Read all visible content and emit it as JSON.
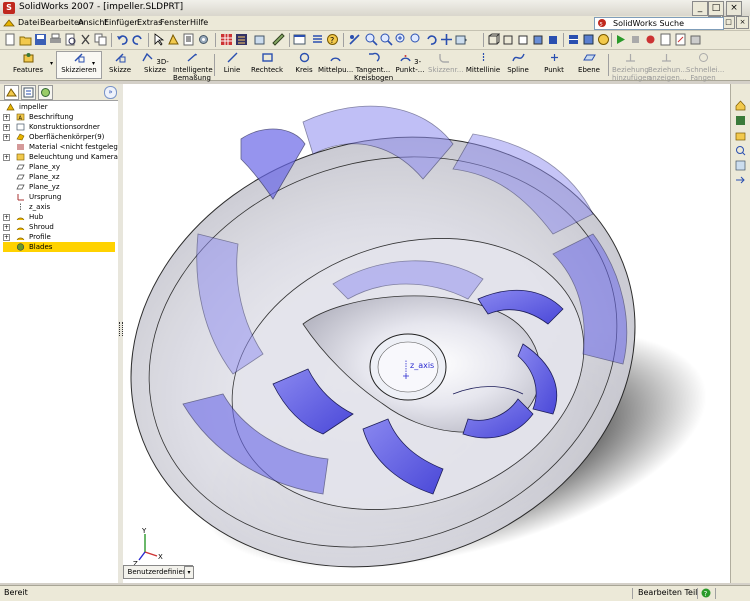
{
  "window": {
    "title": "SolidWorks 2007 - [impeller.SLDPRT]",
    "app_icon": "solidworks-logo",
    "controls": [
      "minimize",
      "restore",
      "close"
    ],
    "doc_controls": [
      "minimize",
      "restore",
      "close"
    ]
  },
  "menu": {
    "items": [
      "Datei",
      "Bearbeiten",
      "Ansicht",
      "Einfügen",
      "Extras",
      "Fenster",
      "Hilfe"
    ],
    "search_placeholder": "SolidWorks Suche"
  },
  "command_manager": {
    "groups": [
      {
        "label": "Features",
        "icon": "features-icon"
      },
      {
        "label": "Skizzieren",
        "icon": "sketch-tab-icon"
      }
    ],
    "tools": [
      {
        "label": "Skizze",
        "icon": "sketch-icon",
        "enabled": true
      },
      {
        "label": "3D-Skizze",
        "icon": "3d-sketch-icon",
        "enabled": true
      },
      {
        "label": "Intelligente Bemaßung",
        "icon": "smart-dimension-icon",
        "enabled": true
      },
      {
        "label": "Linie",
        "icon": "line-icon",
        "enabled": true
      },
      {
        "label": "Rechteck",
        "icon": "rectangle-icon",
        "enabled": true
      },
      {
        "label": "Kreis",
        "icon": "circle-icon",
        "enabled": true
      },
      {
        "label": "Mittelpu...",
        "icon": "centerpoint-arc-icon",
        "enabled": true
      },
      {
        "label": "Tangent... Kreisbogen",
        "icon": "tangent-arc-icon",
        "enabled": true
      },
      {
        "label": "3-Punkt-...",
        "icon": "3-point-arc-icon",
        "enabled": true
      },
      {
        "label": "Skizzenr...",
        "icon": "sketch-fillet-icon",
        "enabled": false
      },
      {
        "label": "Mittellinie",
        "icon": "centerline-icon",
        "enabled": true
      },
      {
        "label": "Spline",
        "icon": "spline-icon",
        "enabled": true
      },
      {
        "label": "Punkt",
        "icon": "point-icon",
        "enabled": true
      },
      {
        "label": "Ebene",
        "icon": "plane-icon",
        "enabled": true
      },
      {
        "label": "Beziehung hinzufügen",
        "icon": "add-relation-icon",
        "enabled": false
      },
      {
        "label": "Beziehun... anzeigen...",
        "icon": "display-relations-icon",
        "enabled": false
      },
      {
        "label": "Schnellei... Fangen",
        "icon": "quick-snaps-icon",
        "enabled": false
      }
    ]
  },
  "feature_manager": {
    "tabs": [
      "featuremanager-tab",
      "propertymanager-tab",
      "configurationmanager-tab"
    ],
    "tree": [
      {
        "label": "impeller",
        "icon": "part-icon",
        "expandable": false,
        "level": 0
      },
      {
        "label": "Beschriftung",
        "icon": "annotations-icon",
        "expandable": true,
        "level": 1
      },
      {
        "label": "Konstruktionsordner",
        "icon": "design-binder-icon",
        "expandable": true,
        "level": 1
      },
      {
        "label": "Oberflächenkörper(9)",
        "icon": "surface-bodies-icon",
        "expandable": true,
        "level": 1
      },
      {
        "label": "Material <nicht festgelegt>",
        "icon": "material-icon",
        "expandable": false,
        "level": 1
      },
      {
        "label": "Beleuchtung und Kameras",
        "icon": "lights-cameras-icon",
        "expandable": true,
        "level": 1
      },
      {
        "label": "Plane_xy",
        "icon": "plane-icon",
        "expandable": false,
        "level": 1
      },
      {
        "label": "Plane_xz",
        "icon": "plane-icon",
        "expandable": false,
        "level": 1
      },
      {
        "label": "Plane_yz",
        "icon": "plane-icon",
        "expandable": false,
        "level": 1
      },
      {
        "label": "Ursprung",
        "icon": "origin-icon",
        "expandable": false,
        "level": 1
      },
      {
        "label": "z_axis",
        "icon": "axis-icon",
        "expandable": false,
        "level": 1
      },
      {
        "label": "Hub",
        "icon": "surface-feature-icon",
        "expandable": true,
        "level": 1
      },
      {
        "label": "Shroud",
        "icon": "surface-feature-icon",
        "expandable": true,
        "level": 1
      },
      {
        "label": "Profile",
        "icon": "surface-feature-icon",
        "expandable": true,
        "level": 1
      },
      {
        "label": "Blades",
        "icon": "blades-icon",
        "expandable": false,
        "level": 1,
        "selected": true
      }
    ]
  },
  "graphics": {
    "axis_label": "z_axis",
    "configuration": "Benutzerdefiniert"
  },
  "status_bar": {
    "left": "Bereit",
    "mode": "Bearbeiten Teil",
    "help_icon": "help-icon"
  },
  "colors": {
    "selected_tree_item": "#ffd200",
    "blade": "#6a68e8",
    "shroud": "#d8d8de"
  }
}
